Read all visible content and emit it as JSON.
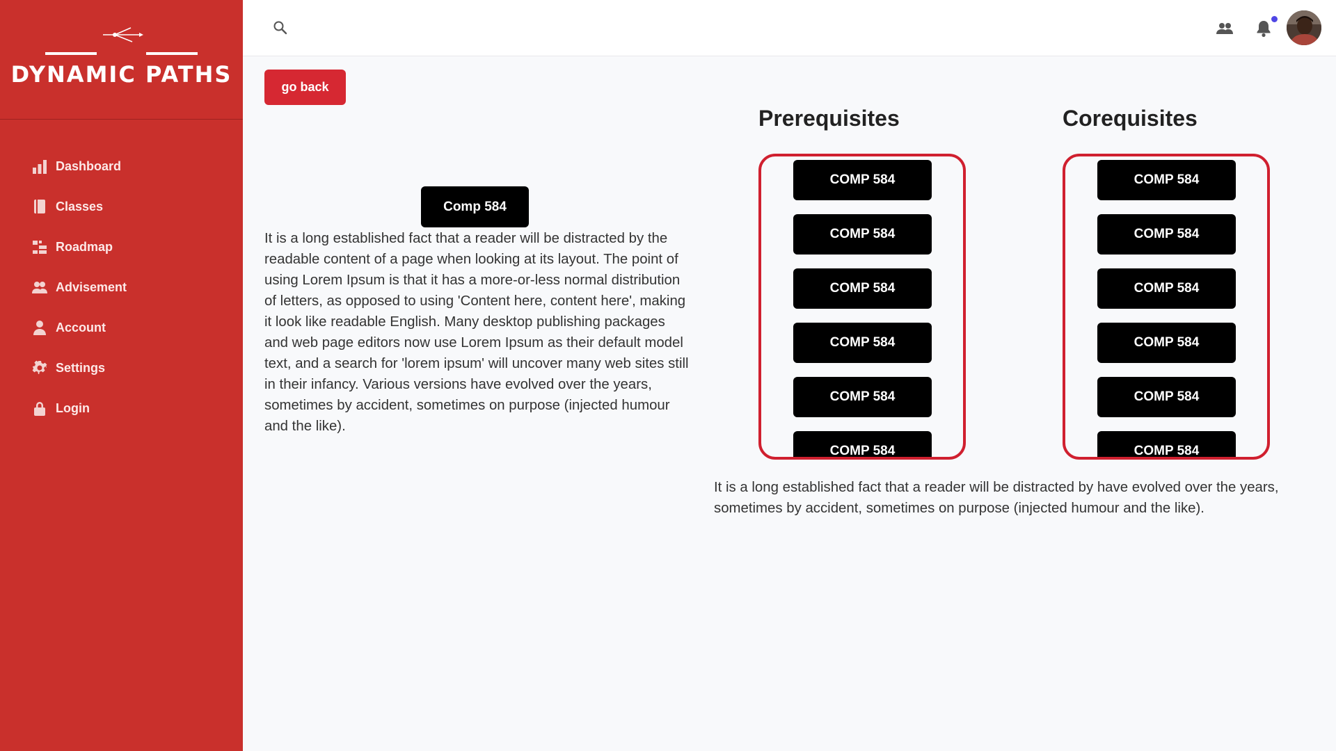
{
  "brand": {
    "name": "DYNAMIC PATHS"
  },
  "colors": {
    "sidebar": "#c9302c",
    "accent": "#d62832",
    "box_border": "#d0202f",
    "notification": "#4f46e5"
  },
  "sidebar": {
    "items": [
      {
        "label": "Dashboard",
        "icon": "bar-chart-icon"
      },
      {
        "label": "Classes",
        "icon": "book-icon"
      },
      {
        "label": "Roadmap",
        "icon": "roadmap-icon"
      },
      {
        "label": "Advisement",
        "icon": "users-icon"
      },
      {
        "label": "Account",
        "icon": "user-icon"
      },
      {
        "label": "Settings",
        "icon": "gear-icon"
      },
      {
        "label": "Login",
        "icon": "lock-icon"
      }
    ]
  },
  "topbar": {
    "search_icon": "search-icon",
    "icons": [
      "users-icon",
      "bell-icon",
      "avatar"
    ]
  },
  "main": {
    "back_label": "go back",
    "course": "Comp 584",
    "description": "It is a long established fact that a reader will be distracted by the readable content of a page when looking at its layout. The point of using Lorem Ipsum is that it has a more-or-less normal distribution of letters, as opposed to using 'Content here, content here', making it look like readable English. Many desktop publishing packages and web page editors now use Lorem Ipsum as their default model text, and a search for 'lorem ipsum' will uncover many web sites still in their infancy. Various versions have evolved over the years, sometimes by accident, sometimes on purpose (injected humour and the like).",
    "prerequisites": {
      "title": "Prerequisites",
      "items": [
        "COMP 584",
        "COMP 584",
        "COMP 584",
        "COMP 584",
        "COMP 584",
        "COMP 584"
      ]
    },
    "corequisites": {
      "title": "Corequisites",
      "items": [
        "COMP 584",
        "COMP 584",
        "COMP 584",
        "COMP 584",
        "COMP 584",
        "COMP 584"
      ]
    },
    "footer_text": "It is a long established fact that a reader will be distracted by have evolved over the years, sometimes by accident, sometimes on purpose (injected humour and the like)."
  }
}
